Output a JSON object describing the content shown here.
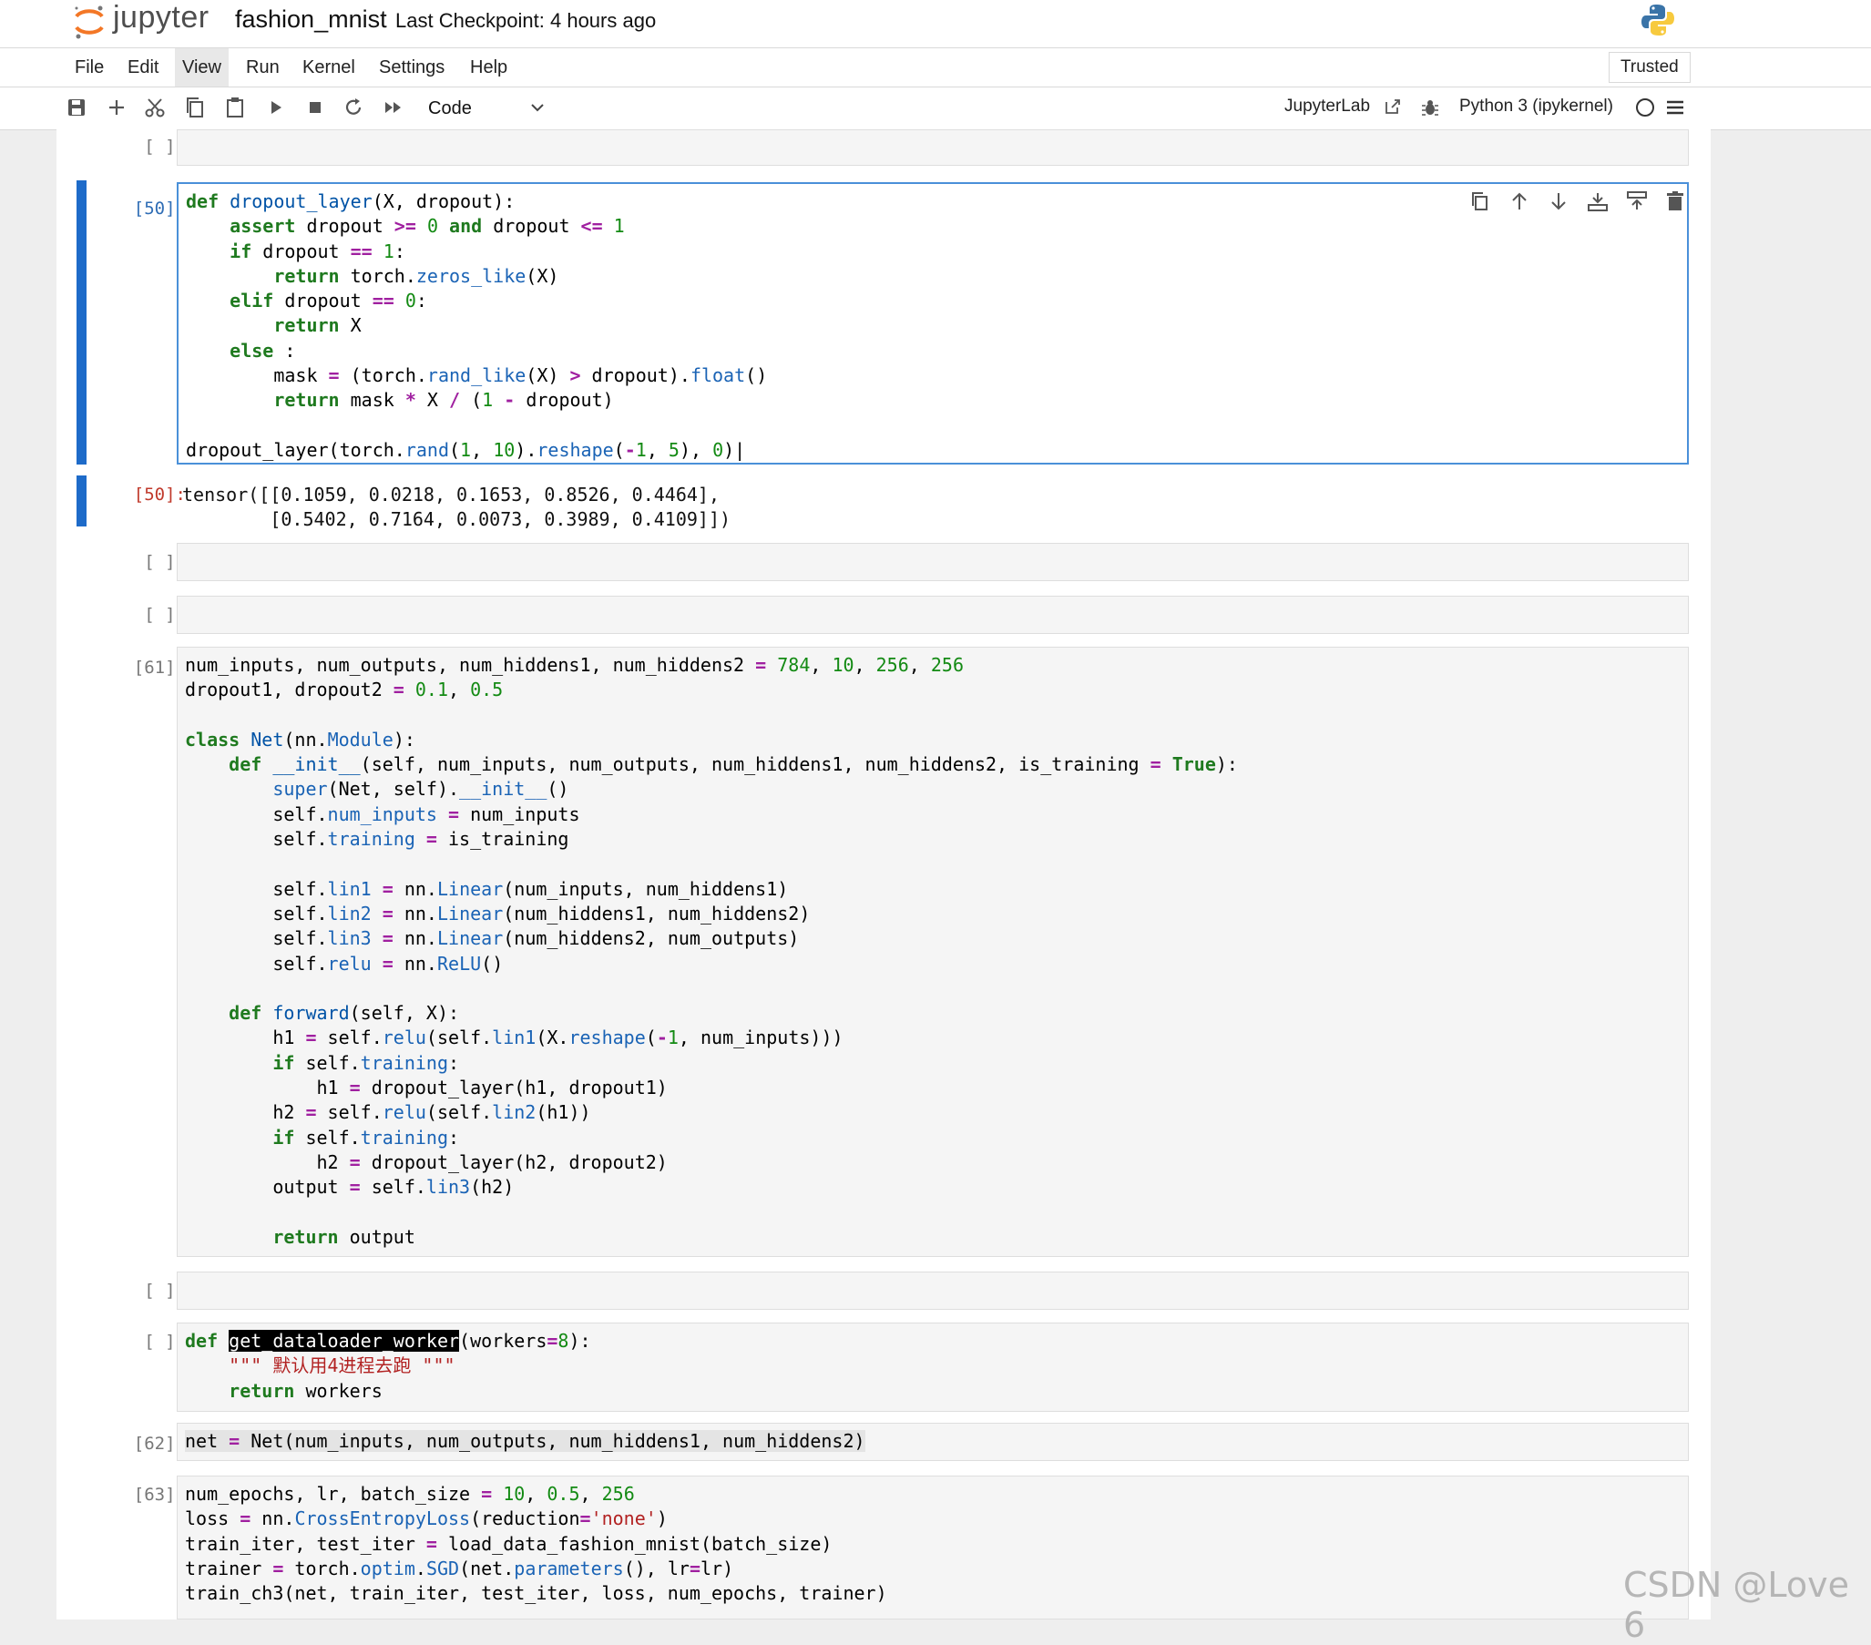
{
  "header": {
    "logo_text": "jupyter",
    "notebook_title": "fashion_mnist",
    "checkpoint": "Last Checkpoint: 4 hours ago"
  },
  "menu": {
    "items": [
      "File",
      "Edit",
      "View",
      "Run",
      "Kernel",
      "Settings",
      "Help"
    ],
    "active": "View",
    "trusted": "Trusted"
  },
  "toolbar": {
    "cell_type": "Code",
    "jupyterlab_link": "JupyterLab",
    "kernel_name": "Python 3 (ipykernel)",
    "icons": [
      "save-icon",
      "add-cell-icon",
      "cut-icon",
      "copy-icon",
      "paste-icon",
      "run-icon",
      "stop-icon",
      "restart-icon",
      "fast-forward-icon"
    ]
  },
  "cells": [
    {
      "prompt": "[ ]:"
    },
    {
      "prompt": "[50]:",
      "selected": true
    },
    {
      "output_prompt": "[50]:",
      "output_text": "tensor([[0.1059, 0.0218, 0.1653, 0.8526, 0.4464],\n        [0.5402, 0.7164, 0.0073, 0.3989, 0.4109]])"
    },
    {
      "prompt": "[ ]:"
    },
    {
      "prompt": "[ ]:"
    },
    {
      "prompt": "[61]:"
    },
    {
      "prompt": "[ ]:"
    },
    {
      "prompt": "[ ]:"
    },
    {
      "prompt": "[62]:"
    },
    {
      "prompt": "[63]:"
    }
  ],
  "cell_toolbar_icons": [
    "duplicate-icon",
    "move-up-icon",
    "move-down-icon",
    "insert-below-icon",
    "insert-above-icon",
    "delete-icon"
  ],
  "watermark": "CSDN @Love 6"
}
